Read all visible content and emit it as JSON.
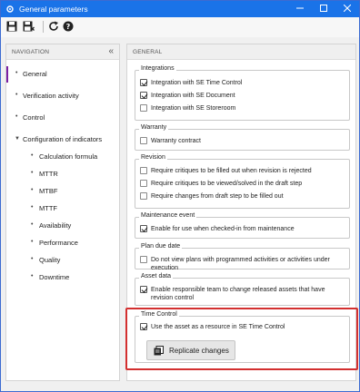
{
  "window": {
    "title": "General parameters",
    "icons": {
      "app": "gear-icon",
      "minimize": "minimize-icon",
      "maximize": "maximize-icon",
      "close": "close-icon"
    }
  },
  "toolbar": {
    "buttons": [
      {
        "name": "save-icon"
      },
      {
        "name": "save-and-close-icon"
      },
      {
        "name": "refresh-icon"
      },
      {
        "name": "help-icon"
      }
    ]
  },
  "navigation": {
    "header": "NAVIGATION",
    "items": [
      {
        "label": "General",
        "active": true
      },
      {
        "label": "Verification activity"
      },
      {
        "label": "Control"
      },
      {
        "label": "Configuration of indicators",
        "expanded": true
      }
    ],
    "sub_items": [
      "Calculation formula",
      "MTTR",
      "MTBF",
      "MTTF",
      "Availability",
      "Performance",
      "Quality",
      "Downtime"
    ]
  },
  "main": {
    "header": "GENERAL",
    "groups": [
      {
        "legend": "Integrations",
        "options": [
          {
            "label": "Integration with SE Time Control",
            "checked": true
          },
          {
            "label": "Integration with SE Document",
            "checked": true
          },
          {
            "label": "Integration with SE Storeroom",
            "checked": false
          }
        ]
      },
      {
        "legend": "Warranty",
        "options": [
          {
            "label": "Warranty contract",
            "checked": false
          }
        ]
      },
      {
        "legend": "Revision",
        "options": [
          {
            "label": "Require critiques to be filled out when revision is rejected",
            "checked": false
          },
          {
            "label": "Require critiques to be viewed/solved in the draft step",
            "checked": false
          },
          {
            "label": "Require changes from draft step to be filled out",
            "checked": false
          }
        ]
      },
      {
        "legend": "Maintenance event",
        "options": [
          {
            "label": "Enable for use when checked-in from maintenance",
            "checked": true
          }
        ]
      },
      {
        "legend": "Plan due date",
        "options": [
          {
            "label": "Do not view plans with programmed activities or activities under execution",
            "checked": false
          }
        ]
      },
      {
        "legend": "Asset data",
        "options": [
          {
            "label": "Enable responsible team to change released assets that have revision control",
            "checked": true
          }
        ]
      },
      {
        "legend": "Time Control",
        "options": [
          {
            "label": "Use the asset as a resource in SE Time Control",
            "checked": true
          }
        ]
      }
    ],
    "replicate_button": "Replicate changes"
  },
  "colors": {
    "titlebar": "#1a73e8",
    "active_nav_marker": "#7b1fa2",
    "highlight": "#d32f2f"
  }
}
